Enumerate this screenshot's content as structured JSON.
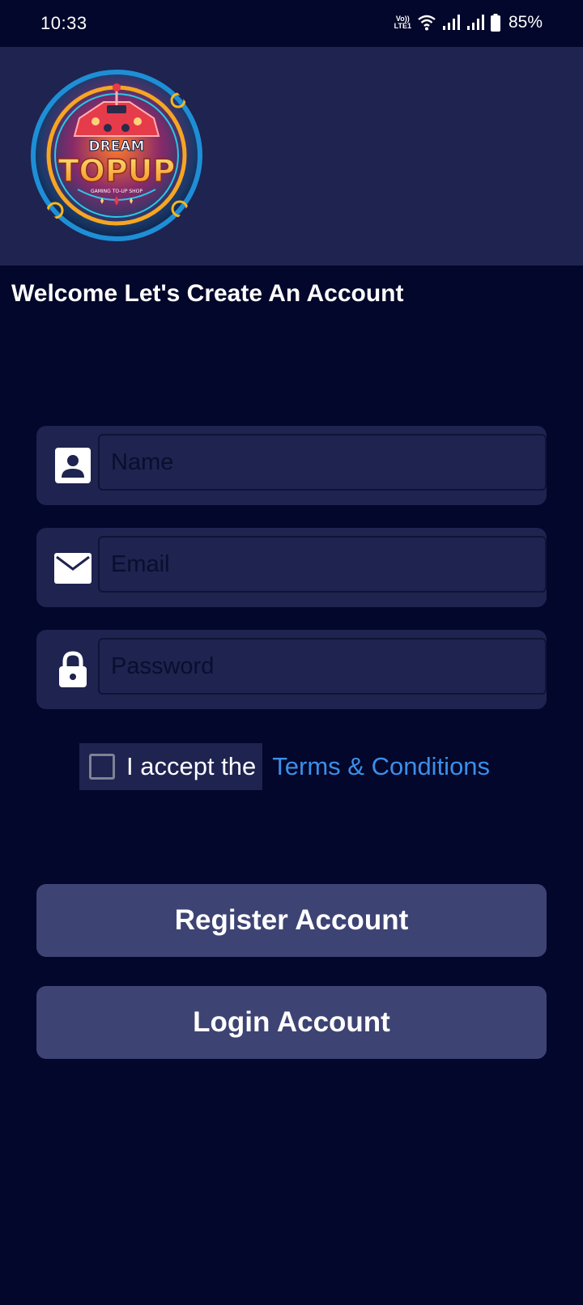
{
  "status_bar": {
    "time": "10:33",
    "volte_top": "Vo))",
    "volte_bottom": "LTE1",
    "battery": "85%"
  },
  "header": {
    "logo_top_text": "DREAM",
    "logo_main_text": "TOPUP",
    "logo_sub_text": "GAMING TO-UP SHOP"
  },
  "welcome_title": "Welcome Let's Create An Account",
  "form": {
    "name_placeholder": "Name",
    "email_placeholder": "Email",
    "password_placeholder": "Password",
    "terms_prefix": "I accept the",
    "terms_link": "Terms & Conditions"
  },
  "buttons": {
    "register": "Register Account",
    "login": "Login Account"
  },
  "colors": {
    "background": "#03072b",
    "header_bg": "#1e2350",
    "button_bg": "#3d4373",
    "link": "#3b8fe8"
  }
}
